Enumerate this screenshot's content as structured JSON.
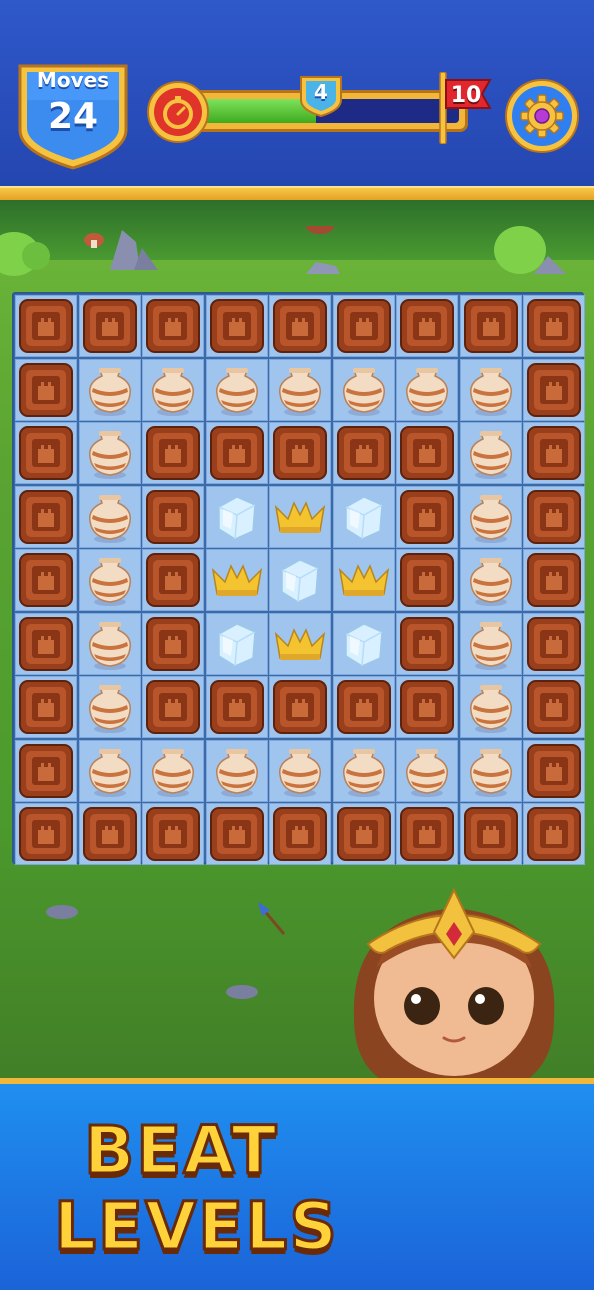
{
  "hud": {
    "moves_label": "Moves",
    "moves_value": "24",
    "milestone_value": "4",
    "goal_value": "10",
    "progress_fraction": 0.45,
    "timer_icon": "stopwatch-icon",
    "settings_icon": "gear-icon"
  },
  "board": {
    "rows": 9,
    "cols": 9,
    "legend": {
      "C": "wooden-crate",
      "P": "clay-pot",
      "I": "ice-cube",
      "K": "gold-crown"
    },
    "grid": [
      "CCCCCCCCC",
      "CPPPPPPPC",
      "CPCCCCCPC",
      "CPCIKICPC",
      "CPCKIKCPC",
      "CPCIKICPC",
      "CPCCCCCPC",
      "CPPPPPPPC",
      "CCCCCCCCC"
    ]
  },
  "banner": {
    "line1": "BEAT",
    "line2": "LEVELS"
  },
  "colors": {
    "header": "#2f58c9",
    "rail": "#f3b83b",
    "grass": "#5aa432",
    "cell": "#9fc4ee",
    "banner": "#1f8ff0",
    "promo_text": "#ffd23a"
  }
}
